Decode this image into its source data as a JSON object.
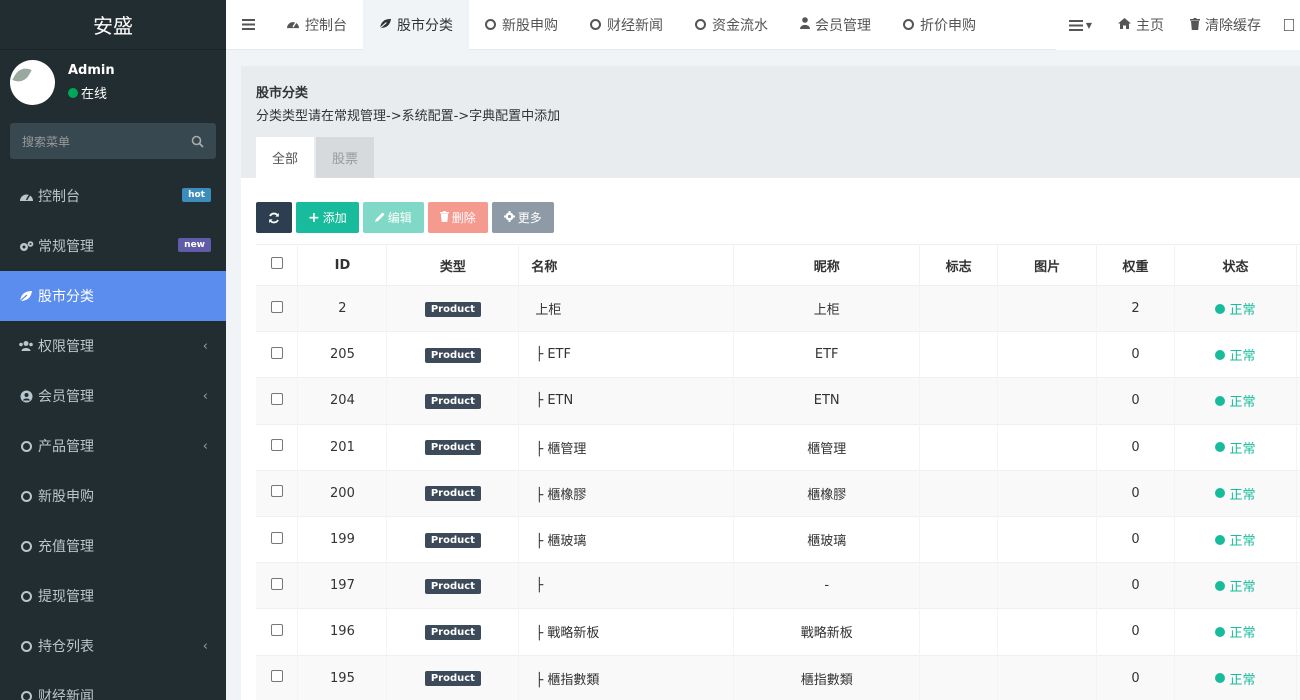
{
  "brand": "安盛",
  "user": {
    "name": "Admin",
    "status": "在线"
  },
  "search": {
    "placeholder": "搜索菜单"
  },
  "sidebar": {
    "items": [
      {
        "label": "控制台",
        "icon": "dashboard-icon",
        "badge": "hot"
      },
      {
        "label": "常规管理",
        "icon": "cogs-icon",
        "badge": "new"
      },
      {
        "label": "股市分类",
        "icon": "leaf-icon",
        "active": true
      },
      {
        "label": "权限管理",
        "icon": "group-icon",
        "chevron": true
      },
      {
        "label": "会员管理",
        "icon": "user-circle-icon",
        "chevron": true
      },
      {
        "label": "产品管理",
        "icon": "circle-icon",
        "chevron": true
      },
      {
        "label": "新股申购",
        "icon": "circle-icon"
      },
      {
        "label": "充值管理",
        "icon": "circle-icon"
      },
      {
        "label": "提现管理",
        "icon": "circle-icon"
      },
      {
        "label": "持仓列表",
        "icon": "circle-icon",
        "chevron": true
      },
      {
        "label": "财经新闻",
        "icon": "circle-icon"
      }
    ]
  },
  "topnav": {
    "tabs": [
      {
        "label": "控制台",
        "icon": "dashboard-icon"
      },
      {
        "label": "股市分类",
        "icon": "leaf-icon",
        "active": true
      },
      {
        "label": "新股申购",
        "icon": "circle-icon"
      },
      {
        "label": "财经新闻",
        "icon": "circle-icon"
      },
      {
        "label": "资金流水",
        "icon": "circle-icon"
      },
      {
        "label": "会员管理",
        "icon": "user-icon"
      },
      {
        "label": "折价申购",
        "icon": "circle-icon"
      }
    ],
    "right": {
      "home": "主页",
      "clear_cache": "清除缓存"
    }
  },
  "panel": {
    "title": "股市分类",
    "description": "分类类型请在常规管理->系统配置->字典配置中添加",
    "tabs": [
      "全部",
      "股票"
    ]
  },
  "toolbar": {
    "add": "添加",
    "edit": "编辑",
    "delete": "删除",
    "more": "更多"
  },
  "table": {
    "headers": [
      "ID",
      "类型",
      "名称",
      "昵称",
      "标志",
      "图片",
      "权重",
      "状态"
    ],
    "rows": [
      {
        "id": "2",
        "type": "Product",
        "name": "上柜",
        "nickname": "上柜",
        "weight": "2",
        "status": "正常"
      },
      {
        "id": "205",
        "type": "Product",
        "name": "├ ETF",
        "nickname": "ETF",
        "weight": "0",
        "status": "正常"
      },
      {
        "id": "204",
        "type": "Product",
        "name": "├ ETN",
        "nickname": "ETN",
        "weight": "0",
        "status": "正常"
      },
      {
        "id": "201",
        "type": "Product",
        "name": "├ 櫃管理",
        "nickname": "櫃管理",
        "weight": "0",
        "status": "正常"
      },
      {
        "id": "200",
        "type": "Product",
        "name": "├ 櫃橡膠",
        "nickname": "櫃橡膠",
        "weight": "0",
        "status": "正常"
      },
      {
        "id": "199",
        "type": "Product",
        "name": "├ 櫃玻璃",
        "nickname": "櫃玻璃",
        "weight": "0",
        "status": "正常"
      },
      {
        "id": "197",
        "type": "Product",
        "name": "├",
        "nickname": "-",
        "weight": "0",
        "status": "正常"
      },
      {
        "id": "196",
        "type": "Product",
        "name": "├ 戰略新板",
        "nickname": "戰略新板",
        "weight": "0",
        "status": "正常"
      },
      {
        "id": "195",
        "type": "Product",
        "name": "├ 櫃指數類",
        "nickname": "櫃指數類",
        "weight": "0",
        "status": "正常"
      }
    ]
  },
  "colors": {
    "sidebar_bg": "#222d32",
    "active": "#5b8def",
    "success": "#18bc9c",
    "primary_dark": "#2c3e50"
  }
}
